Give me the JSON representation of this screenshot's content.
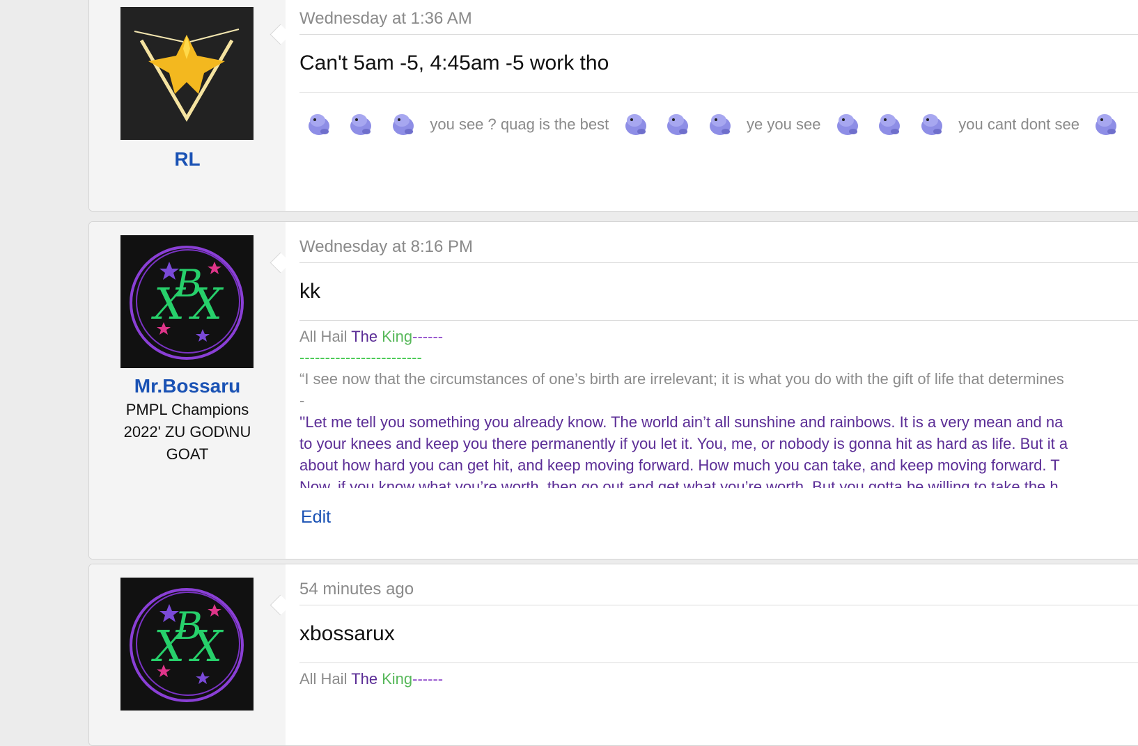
{
  "posts": [
    {
      "username": "RL",
      "avatar": "instinct-team-logo",
      "date": "Wednesday at 1:36 AM",
      "message": "Can't 5am -5, 4:45am -5 work tho",
      "signature": {
        "icon": "quagsire-sprite",
        "texts": [
          "you see ? quag is the best",
          "ye you see",
          "you cant dont see"
        ]
      }
    },
    {
      "username": "Mr.Bossaru",
      "user_title": "PMPL Champions 2022' ZU GOD\\NU GOAT",
      "avatar": "xbx-circle-logo",
      "date": "Wednesday at 8:16 PM",
      "message": "kk",
      "signature": {
        "all_hail": "All Hail",
        "the": "The",
        "king": "King",
        "dashes1": "------",
        "dashes2": "------------------------",
        "quote1": "“I see now that the circumstances of one’s birth are irrelevant; it is what you do with the gift of life that determines",
        "dash": "-",
        "quote2_line1": "''Let me tell you something you already know. The world ain’t all sunshine and rainbows. It is a very mean and na",
        "quote2_line2": "to your knees and keep you there permanently if you let it. You, me, or nobody is gonna hit as hard as life. But it a",
        "quote2_line3": "about how hard you can get hit, and keep moving forward. How much you can take, and keep moving forward. T",
        "quote2_line4": "Now, if you know what you’re worth, then go out and get what you’re worth. But you gotta be willing to take the h"
      },
      "edit_label": "Edit"
    },
    {
      "avatar": "xbx-circle-logo",
      "date": "54 minutes ago",
      "message": "xbossarux",
      "signature": {
        "all_hail": "All Hail",
        "the": "The",
        "king": "King",
        "dashes1": "------"
      }
    }
  ],
  "colors": {
    "link": "#1a52b4",
    "purple": "#5b2d96",
    "green": "#57b85a",
    "violet": "#8b42c9"
  }
}
